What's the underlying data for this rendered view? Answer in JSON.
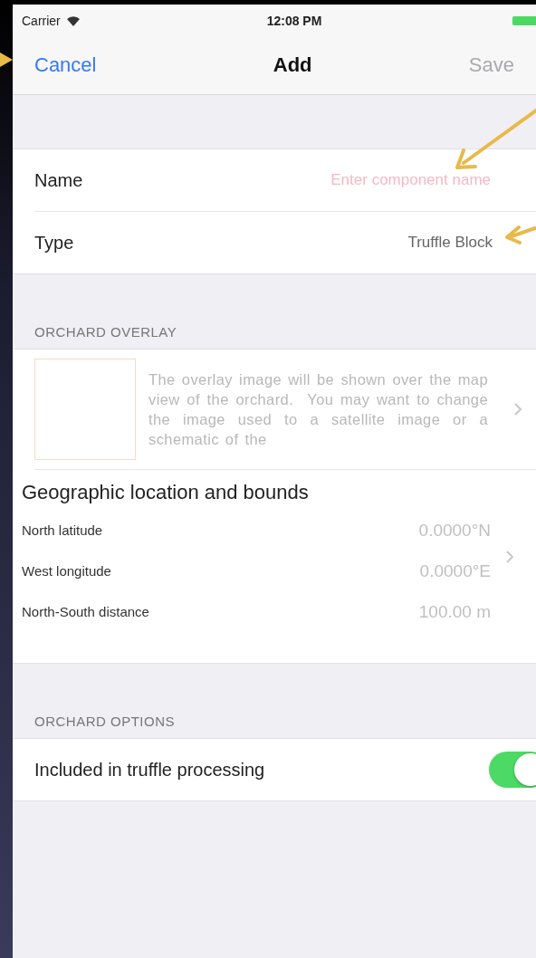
{
  "status_bar": {
    "carrier": "Carrier",
    "time": "12:08 PM"
  },
  "nav": {
    "cancel": "Cancel",
    "title": "Add",
    "save": {
      "label": "Save",
      "disabled": true
    }
  },
  "fields": [
    {
      "kind": "input",
      "label": "Name",
      "placeholder": "Enter component name"
    },
    {
      "kind": "value",
      "label": "Type",
      "value": "Truffle Block"
    }
  ],
  "overlay_section": {
    "header": "ORCHARD OVERLAY",
    "description": "The overlay image will be shown over the map view of the orchard.  You may want to change the image used to a satellite image or a schematic of the"
  },
  "geo": {
    "title": "Geographic location and bounds",
    "rows": [
      {
        "label": "North latitude",
        "value": "0.0000°N"
      },
      {
        "label": "West longitude",
        "value": "0.0000°E"
      },
      {
        "label": "North-South distance",
        "value": "100.00 m"
      }
    ]
  },
  "options_section": {
    "header": "ORCHARD OPTIONS",
    "options": [
      {
        "label": "Included in truffle processing",
        "on": true
      }
    ]
  }
}
